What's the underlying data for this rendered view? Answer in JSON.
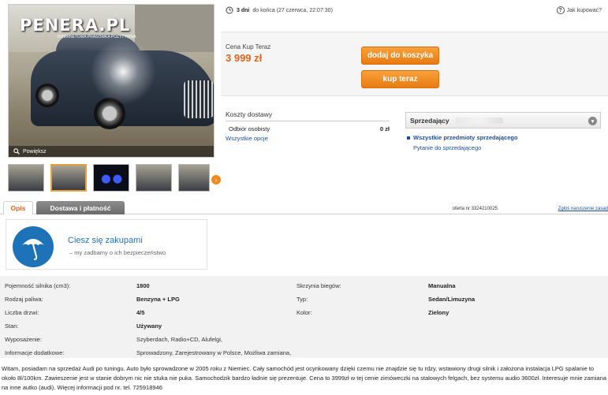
{
  "photo": {
    "watermark": "PENERA.PL",
    "watermark_sub": "INTERNETOWA PRASÓWKA POZYTYWNA",
    "zoom_label": "Powiększ"
  },
  "thumbnails": [
    {
      "label": "car-front"
    },
    {
      "label": "car-side"
    },
    {
      "label": "car-lights-night"
    },
    {
      "label": "car-interior"
    },
    {
      "label": "car-rear"
    }
  ],
  "ending": {
    "bold": "3 dni",
    "rest": "do końca (27 czerwca, 22:07:30)"
  },
  "help_link": "Jak kupować?",
  "buy": {
    "price_label": "Cena Kup Teraz",
    "price": "3 999 zł",
    "add_to_cart": "dodaj do koszyka",
    "buy_now": "kup teraz"
  },
  "shipping": {
    "title": "Koszty dostawy",
    "option": "Odbiór osobisty",
    "option_price": "0 zł",
    "all_options_link": "Wszystkie opcje"
  },
  "seller": {
    "label": "Sprzedający",
    "all_items_link": "Wszystkie przedmioty sprzedającego",
    "ask_link": "Pytanie do sprzedającego"
  },
  "tabs": {
    "description": "Opis",
    "delivery": "Dostawa i płatność",
    "offer_number": "oferta nr 3324210025",
    "report_link": "Zgłoś naruszenie zasad"
  },
  "safety": {
    "title": "Ciesz się zakupami",
    "subtitle": "– my zadbamy o ich bezpieczeństwo"
  },
  "params": [
    {
      "l1": "Pojemność silnika (cm3):",
      "v1": "1800",
      "l2": "Skrzynia biegów:",
      "v2": "Manualna"
    },
    {
      "l1": "Rodzaj paliwa:",
      "v1": "Benzyna + LPG",
      "l2": "Typ:",
      "v2": "Sedan/Limuzyna"
    },
    {
      "l1": "Liczba drzwi:",
      "v1": "4/5",
      "l2": "Kolor:",
      "v2": "Zielony"
    },
    {
      "l1": "Stan:",
      "v1": "Używany",
      "l2": "",
      "v2": ""
    },
    {
      "l1": "Wyposażenie:",
      "v1": "Szyberdach, Radio+CD, Alufelgi,",
      "l2": "",
      "v2": ""
    },
    {
      "l1": "Informacje dodatkowe:",
      "v1": "Sprowadzony, Zarejestrowany w Polsce, Możliwa zamiana,",
      "l2": "",
      "v2": ""
    }
  ],
  "description": "Witam, posiadam na sprzedaż Audi po tuningu. Auto było sprowadzone w 2005 roku z Niemiec. Cały samochód jest ocynkowany dzięki czemu nie znajdzie się tu rdzy, wstawiony drugi silnik i założona instalacja LPG spalanie to około 8l/100km. Zawieszenie jest w stanie dobrym nic nie stuka nie puka. Samochodzik bardzo ładnie się prezentuje. Cena to 3999zł w tej cenie zimóweczki na stalowych felgach, bez systemu audio 3600zł. Interesuje mnie zamiana na inne autko (audi). Więcej informacji pod nr. tel. 725918946",
  "colors": {
    "accent_orange": "#e87b11",
    "price_orange": "#e1631c",
    "link_blue": "#1d4e91",
    "brand_blue": "#1e72b8"
  }
}
